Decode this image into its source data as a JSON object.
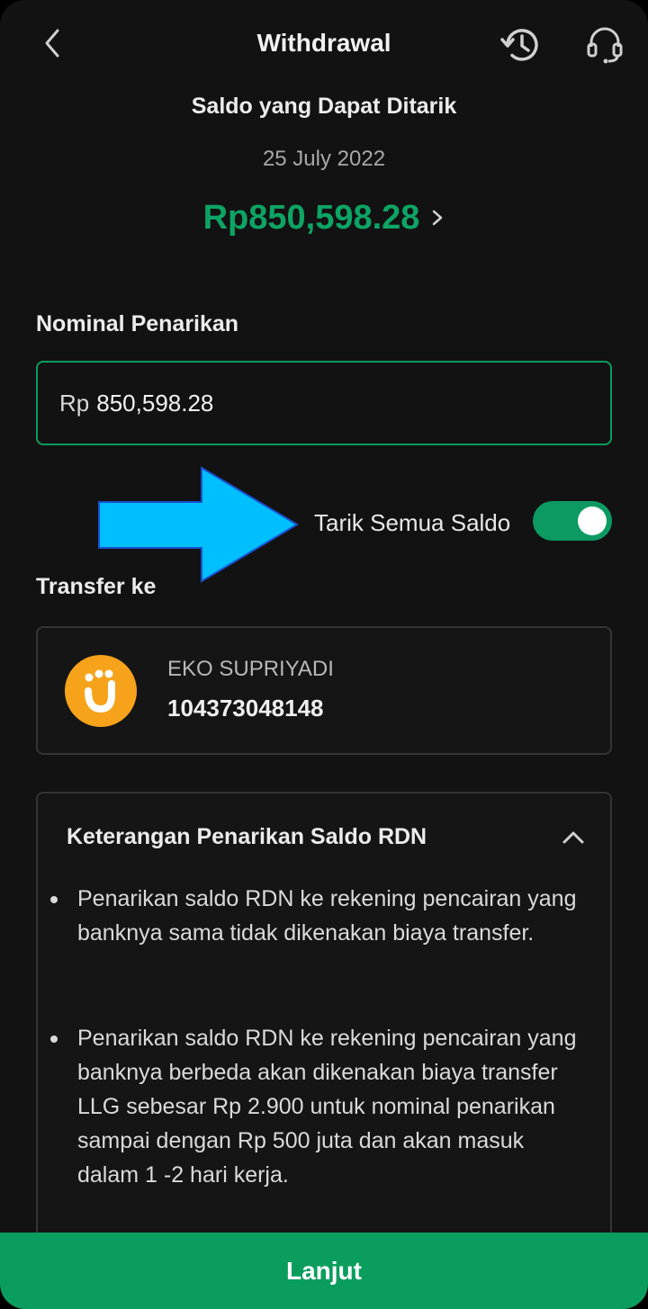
{
  "header": {
    "title": "Withdrawal",
    "back_icon": "chevron-left-icon",
    "history_icon": "history-icon",
    "support_icon": "headset-icon"
  },
  "balance": {
    "label": "Saldo yang Dapat Ditarik",
    "date": "25 July 2022",
    "amount": "Rp850,598.28",
    "amount_color": "#0da465"
  },
  "withdrawal": {
    "label": "Nominal Penarikan",
    "currency_prefix": "Rp",
    "amount_value": "850,598.28",
    "input_border_color": "#0a9d5e"
  },
  "toggle": {
    "label": "Tarik Semua Saldo",
    "checked": true,
    "color": "#0c9a62"
  },
  "annotation": {
    "icon": "arrow-right-icon",
    "color": "#00bfff"
  },
  "transfer": {
    "label": "Transfer ke",
    "account_name": "EKO SUPRIYADI",
    "account_number": "104373048148",
    "bank_logo_color": "#f6a31b"
  },
  "info": {
    "title": "Keterangan Penarikan Saldo RDN",
    "expanded": true,
    "items": [
      "Penarikan saldo RDN ke rekening pencairan yang banknya sama tidak dikenakan biaya transfer.",
      "Penarikan saldo RDN ke rekening pencairan yang banknya berbeda akan dikenakan biaya transfer LLG sebesar Rp 2.900 untuk nominal penarikan sampai dengan Rp 500 juta dan akan masuk dalam 1 -2 hari kerja."
    ]
  },
  "footer": {
    "button_label": "Lanjut",
    "button_color": "#0a9d5e"
  }
}
